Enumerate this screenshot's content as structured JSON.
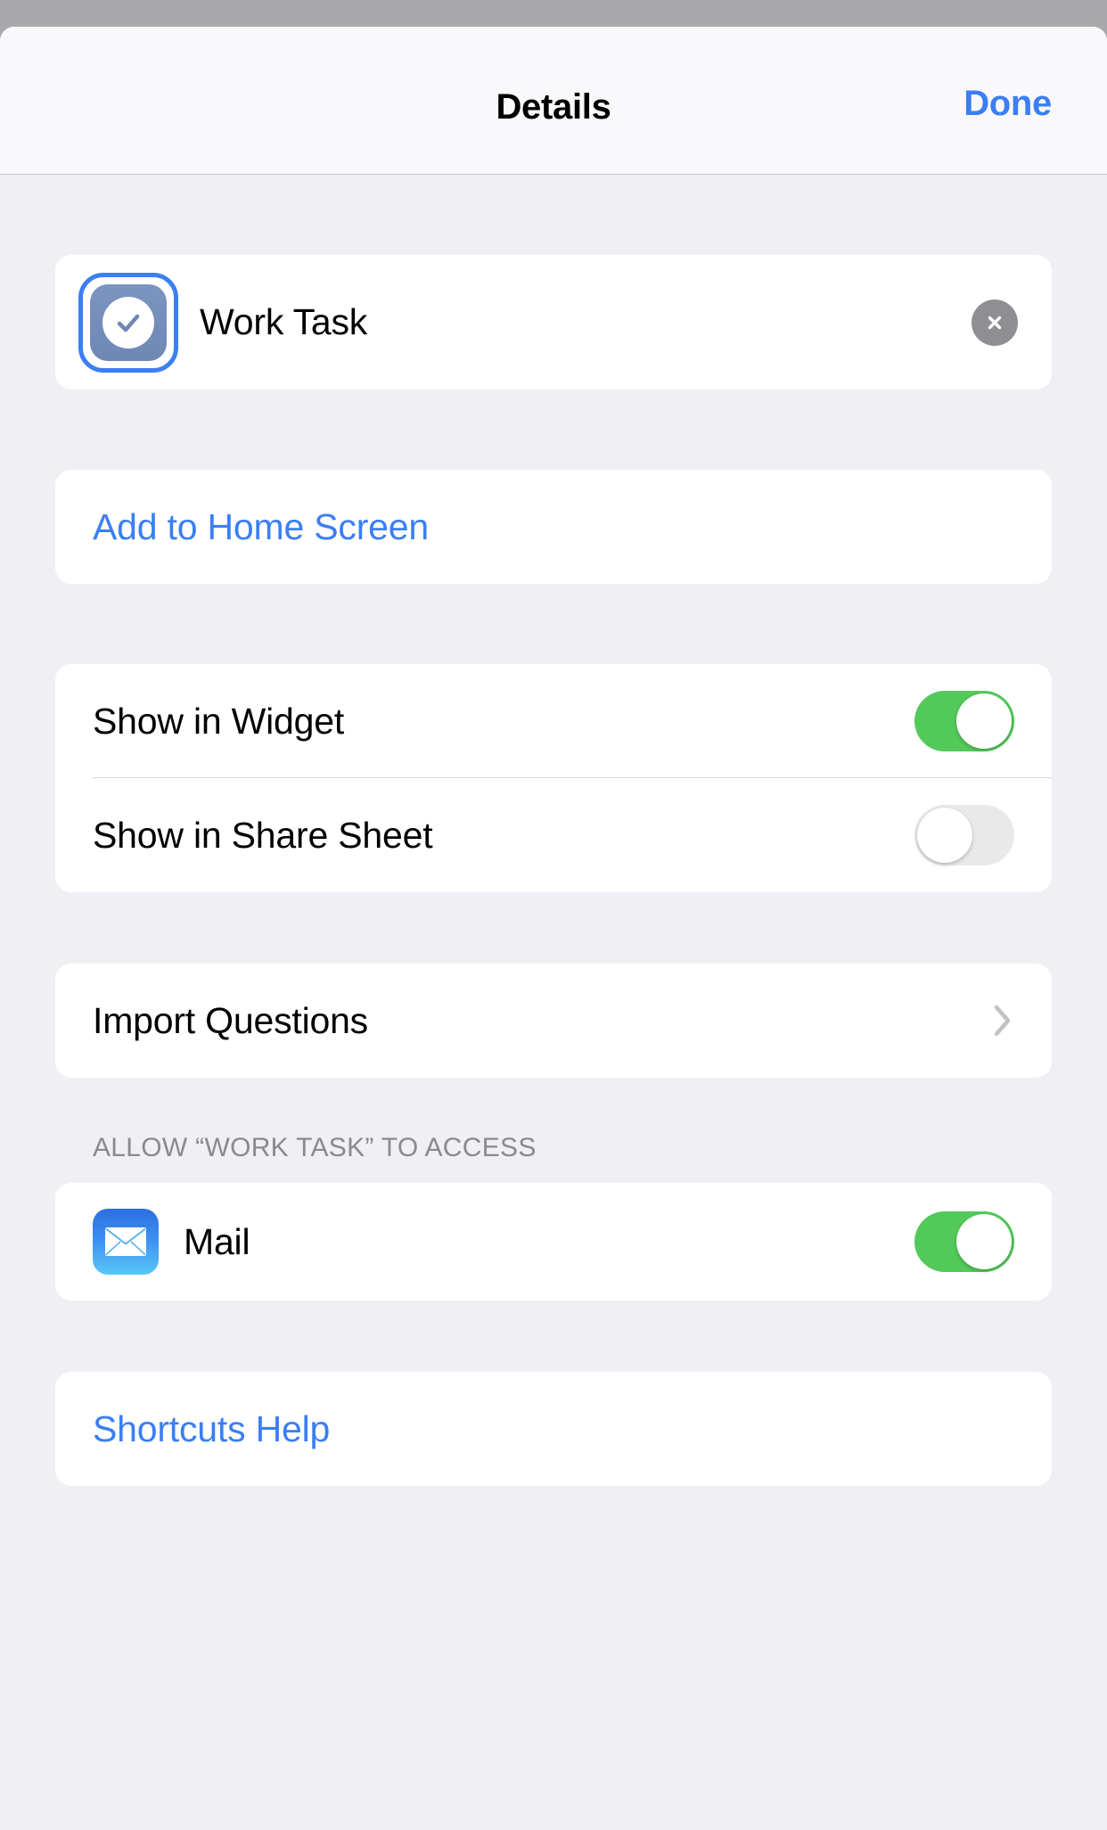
{
  "navbar": {
    "title": "Details",
    "done_label": "Done"
  },
  "shortcut": {
    "name": "Work Task",
    "icon": "checkmark-circle-icon",
    "clear_icon": "close-circle-icon"
  },
  "add_to_home": {
    "label": "Add to Home Screen"
  },
  "switches": [
    {
      "label": "Show in Widget",
      "state": "on"
    },
    {
      "label": "Show in Share Sheet",
      "state": "off"
    }
  ],
  "import_questions": {
    "label": "Import Questions",
    "disclosure_icon": "chevron-right-icon"
  },
  "access_section": {
    "header": "ALLOW “WORK TASK” TO ACCESS",
    "apps": [
      {
        "name": "Mail",
        "icon": "mail-icon",
        "state": "on"
      }
    ]
  },
  "help": {
    "label": "Shortcuts Help"
  },
  "colors": {
    "accent_blue": "#3b7ef5",
    "toggle_on_green": "#53c95a",
    "toggle_off_gray": "#e9e9ea",
    "background": "#f0eff4",
    "card": "#ffffff",
    "secondary_text": "#8a8a8e",
    "backdrop": "#a9a9ac"
  }
}
